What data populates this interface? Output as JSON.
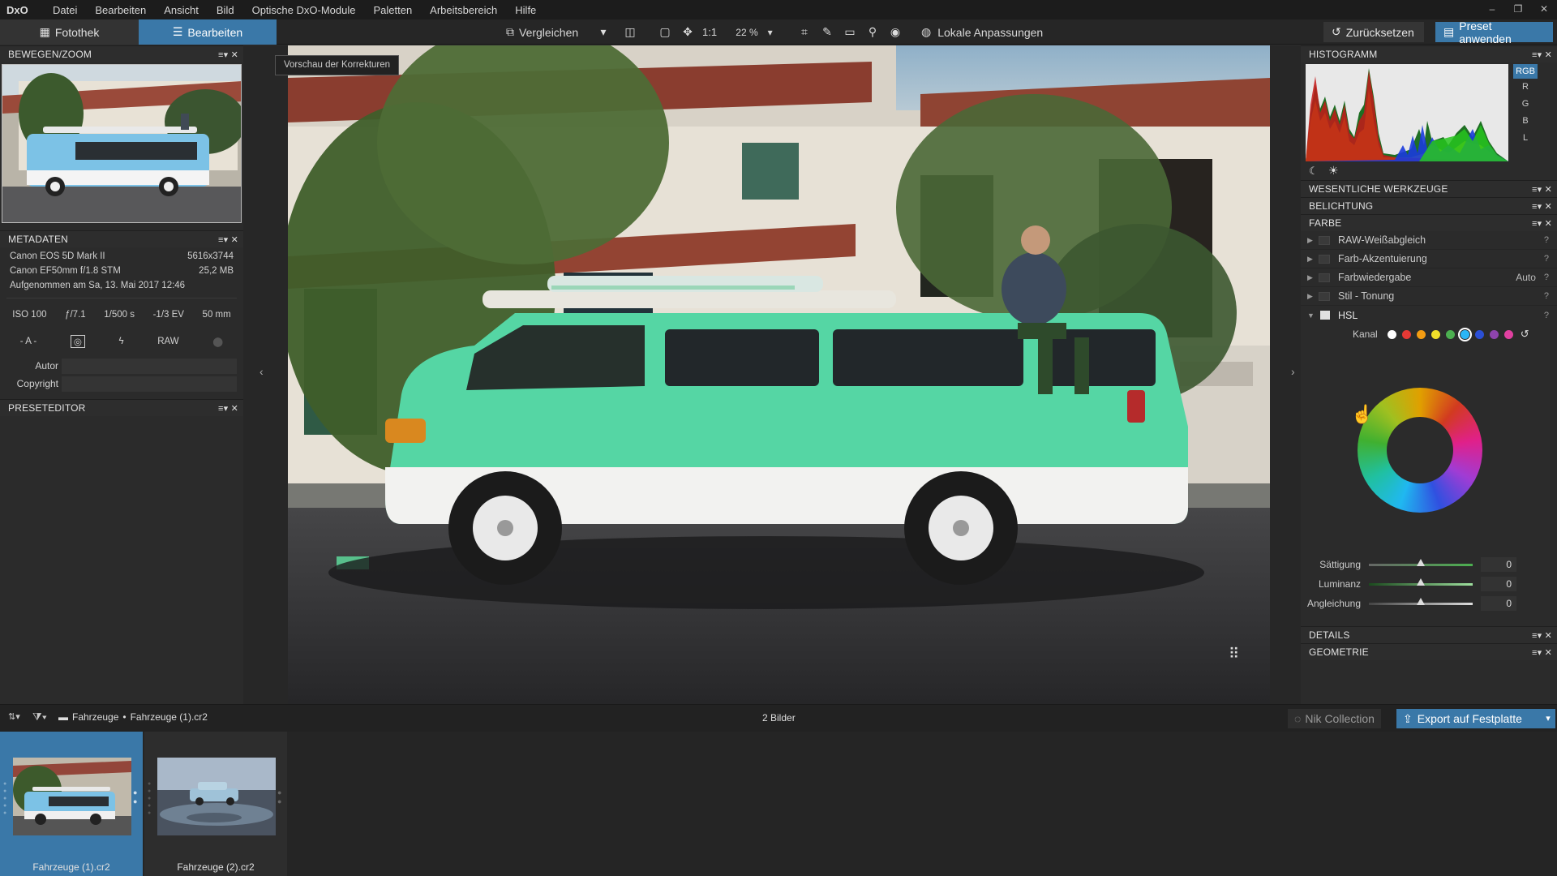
{
  "app": {
    "logo": "DxO"
  },
  "menu": [
    "Datei",
    "Bearbeiten",
    "Ansicht",
    "Bild",
    "Optische DxO-Module",
    "Paletten",
    "Arbeitsbereich",
    "Hilfe"
  ],
  "tabs": {
    "library": "Fotothek",
    "edit": "Bearbeiten"
  },
  "toolbar": {
    "compare": "Vergleichen",
    "one_to_one": "1:1",
    "zoom": "22 %",
    "local_adjustments": "Lokale Anpassungen",
    "reset": "Zurücksetzen",
    "apply_preset": "Preset anwenden"
  },
  "left": {
    "panel_move_zoom": "BEWEGEN/ZOOM",
    "panel_metadata": "METADATEN",
    "camera": "Canon EOS 5D Mark II",
    "resolution": "5616x3744",
    "lens": "Canon EF50mm f/1.8 STM",
    "filesize": "25,2 MB",
    "taken": "Aufgenommen am Sa, 13. Mai 2017 12:46",
    "iso": "ISO 100",
    "aperture": "ƒ/7.1",
    "shutter": "1/500 s",
    "ev": "-1/3 EV",
    "focal": "50 mm",
    "mode": "A",
    "raw": "RAW",
    "author_label": "Autor",
    "copyright_label": "Copyright",
    "panel_preset_editor": "PRESETEDITOR"
  },
  "viewer": {
    "tooltip": "Vorschau der Korrekturen"
  },
  "right": {
    "histogram_title": "HISTOGRAMM",
    "channels": [
      "RGB",
      "R",
      "G",
      "B",
      "L"
    ],
    "essential_tools": "WESENTLICHE WERKZEUGE",
    "exposure": "BELICHTUNG",
    "color": "FARBE",
    "tools": [
      {
        "label": "RAW-Weißabgleich",
        "extra": ""
      },
      {
        "label": "Farb-Akzentuierung",
        "extra": ""
      },
      {
        "label": "Farbwiedergabe",
        "extra": "Auto"
      },
      {
        "label": "Stil - Tonung",
        "extra": ""
      }
    ],
    "hsl": "HSL",
    "channel_label": "Kanal",
    "swatches": [
      "#ffffff",
      "#e53935",
      "#f39c12",
      "#f1e02a",
      "#4caf50",
      "#29b6f6",
      "#2b4fd6",
      "#8e44ad",
      "#e040a0"
    ],
    "saturation": "Sättigung",
    "luminance": "Luminanz",
    "uniformity": "Angleichung",
    "sat_val": "0",
    "lum_val": "0",
    "uni_val": "0",
    "details": "DETAILS",
    "geometry": "GEOMETRIE"
  },
  "bottom": {
    "path_folder": "Fahrzeuge",
    "path_file": "Fahrzeuge (1).cr2",
    "count": "2 Bilder",
    "nik": "Nik Collection",
    "export": "Export auf Festplatte"
  },
  "filmstrip": [
    {
      "name": "Fahrzeuge (1).cr2",
      "selected": true
    },
    {
      "name": "Fahrzeuge (2).cr2",
      "selected": false
    }
  ]
}
